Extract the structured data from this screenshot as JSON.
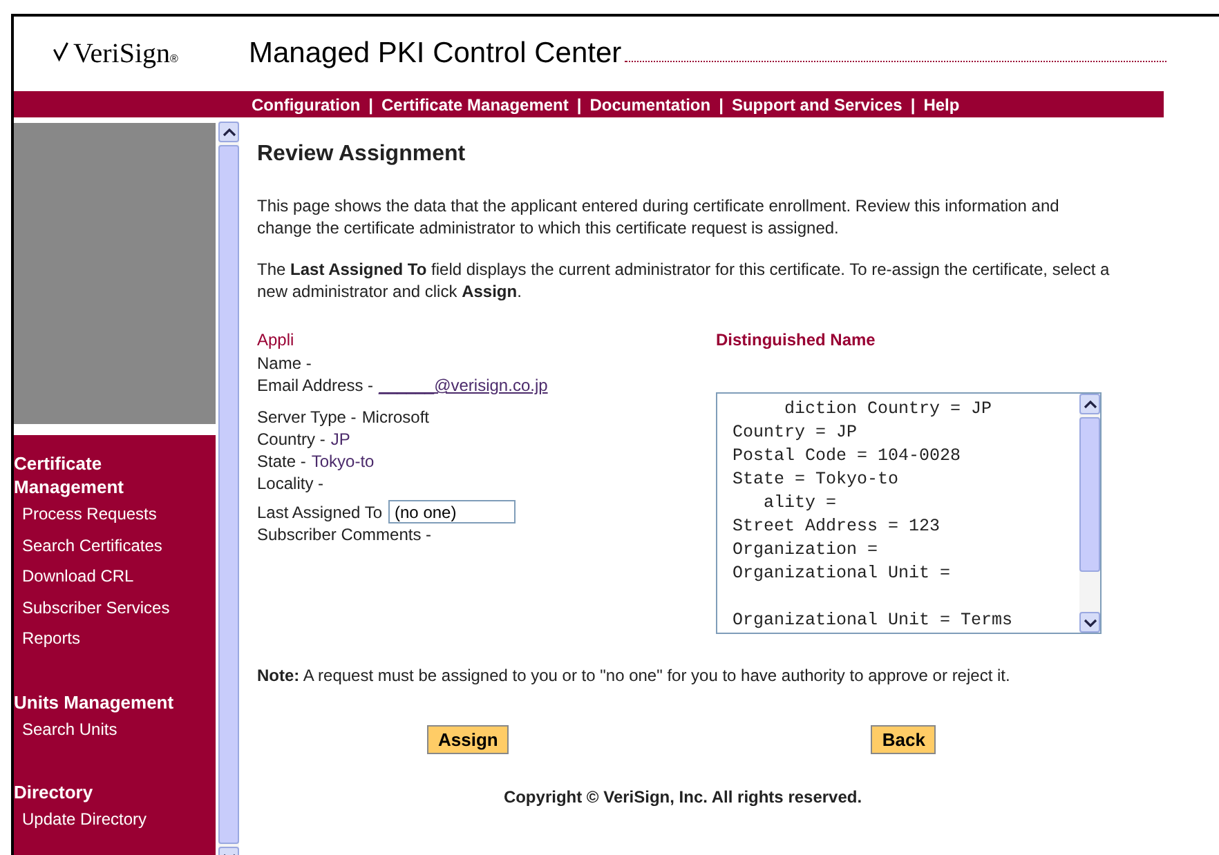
{
  "header": {
    "logo": "VeriSign",
    "logo_mark": "®",
    "title": "Managed PKI Control Center"
  },
  "nav_separator": "|",
  "nav": [
    "Configuration",
    "Certificate Management",
    "Documentation",
    "Support and Services",
    "Help"
  ],
  "sidebar": {
    "sections": [
      {
        "heading": "Certificate Management",
        "items": [
          "Process Requests",
          "Search Certificates",
          "Download CRL",
          "Subscriber Services",
          "Reports"
        ]
      },
      {
        "heading": "Units Management",
        "items": [
          "Search Units"
        ]
      },
      {
        "heading": "Directory",
        "items": [
          "Update Directory"
        ]
      }
    ]
  },
  "page": {
    "title": "Review Assignment",
    "intro": "This page shows the data that the applicant entered during certificate enrollment. Review this information and change the certificate administrator to which this certificate request is assigned.",
    "hint": "The **Last Assigned To** field displays the current administrator for this certificate. To re-assign the certificate, select a new administrator and click **Assign**.",
    "applicant": {
      "heading": "Appli",
      "fields": [
        {
          "label": "Name -"
        },
        {
          "label": "Email Address -",
          "value": "______@verisign.co.jp",
          "kind": "link"
        }
      ],
      "server_fields": [
        {
          "label": "Server Type -",
          "value": "Microsoft",
          "kind": "plain"
        },
        {
          "label": "Country -",
          "value": "JP",
          "kind": "colored"
        },
        {
          "label": "State -",
          "value": "Tokyo-to",
          "kind": "colored"
        },
        {
          "label": "Locality -"
        }
      ],
      "assigned": {
        "label": "Last Assigned To",
        "value": "(no one)"
      },
      "comments": "Subscriber Comments -"
    },
    "dn": {
      "heading": "Distinguished Name",
      "lines": [
        {
          "text": "     diction Country = JP"
        },
        {
          "text": "Country = JP"
        },
        {
          "text": "Postal Code = 104-0028"
        },
        {
          "text": "State = Tokyo-to"
        },
        {
          "text": "   ality ="
        },
        {
          "text": "Street Address = 123"
        },
        {
          "text": "Organization ="
        },
        {
          "text": "Organizational Unit ="
        },
        {
          "text": "Organizational Unit = Terms",
          "gap_before": true
        }
      ]
    },
    "note": "**Note:** A request must be assigned to you or to \"no one\" for you to have authority to approve or reject it.",
    "buttons": [
      "Assign",
      "Back"
    ],
    "copyright": "Copyright © VeriSign, Inc. All rights reserved."
  }
}
